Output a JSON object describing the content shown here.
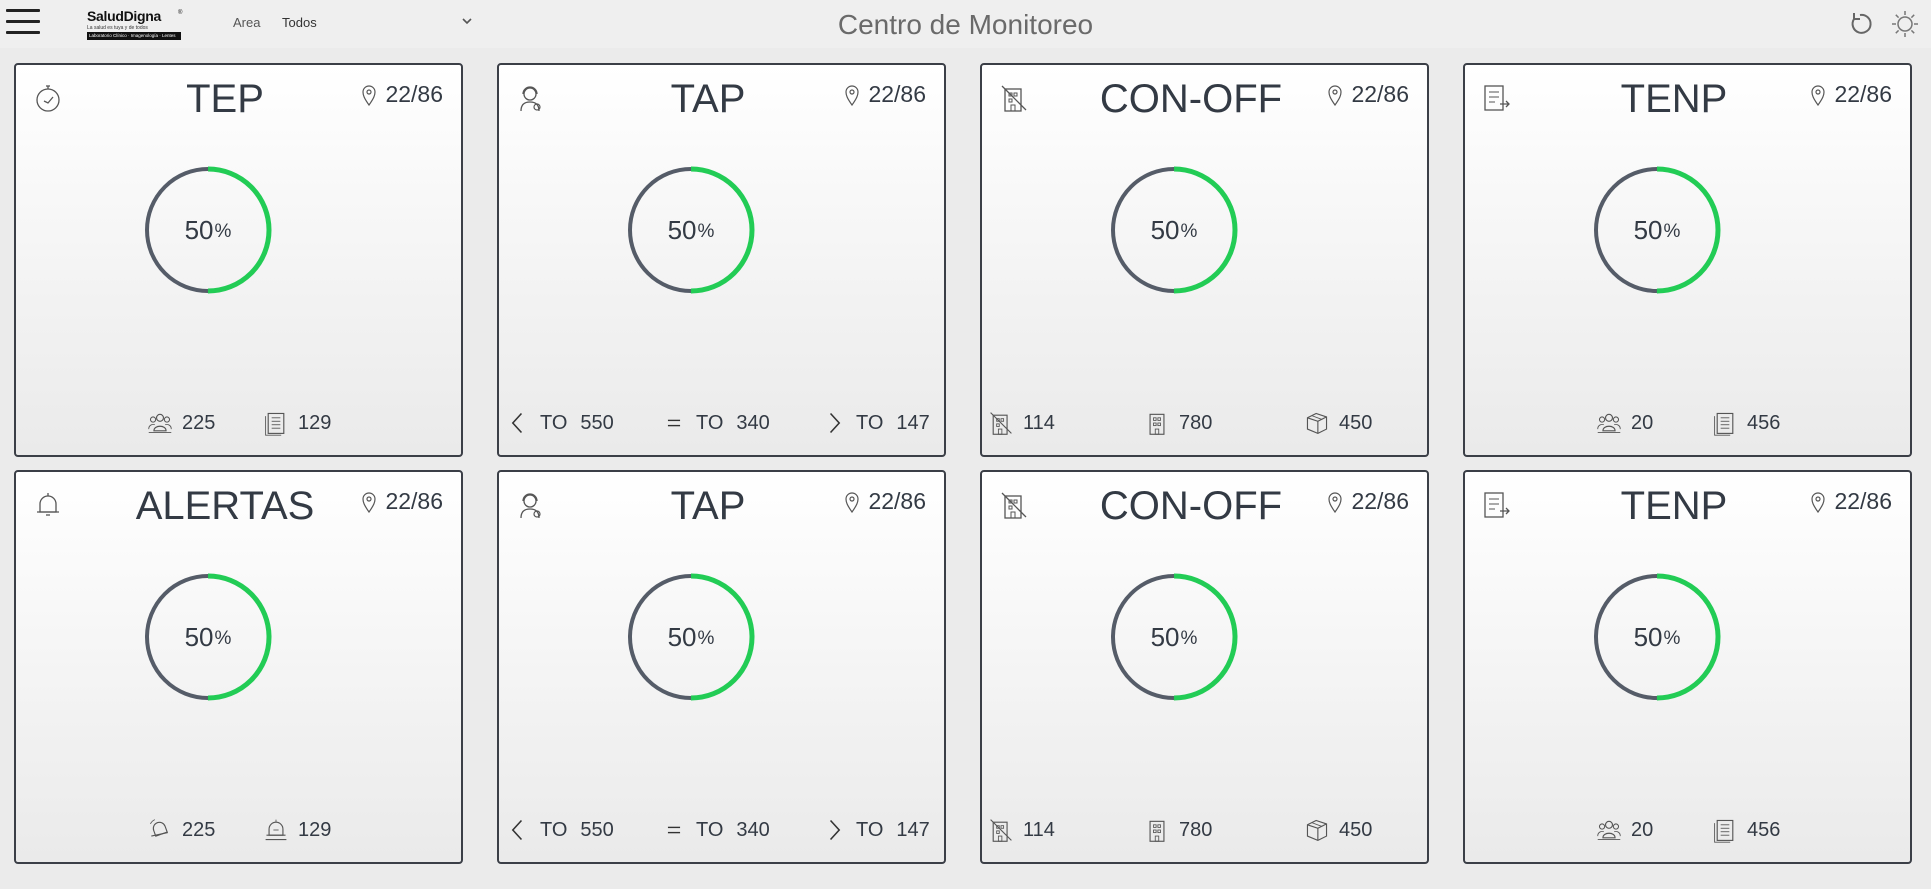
{
  "header": {
    "brand_name": "SaludDigna",
    "brand_reg": "®",
    "brand_tagline": "La salud es tuya y de todos",
    "brand_bar": "Laboratorio Clínico · Imagenología · Lentes",
    "area_label": "Area",
    "area_value": "Todos",
    "title": "Centro de Monitoreo",
    "icons": [
      "menu-icon",
      "chevron-down-icon",
      "refresh-icon",
      "sun-icon"
    ]
  },
  "cards": [
    {
      "title": "TEP",
      "icon": "stopwatch-icon",
      "location": "22/86",
      "percent_value": "50",
      "percent_sign": "%",
      "progress": 0.5,
      "stats": [
        {
          "icon": "users-group-icon",
          "value": "225"
        },
        {
          "icon": "document-list-icon",
          "value": "129"
        }
      ]
    },
    {
      "title": "TAP",
      "icon": "agent-headset-icon",
      "location": "22/86",
      "percent_value": "50",
      "percent_sign": "%",
      "progress": 0.5,
      "stats": [
        {
          "icon": "less-than-icon",
          "prefix": "TO",
          "value": "550"
        },
        {
          "icon": "equals-icon",
          "prefix": "TO",
          "value": "340"
        },
        {
          "icon": "greater-than-icon",
          "prefix": "TO",
          "value": "147"
        }
      ]
    },
    {
      "title": "CON-OFF",
      "icon": "building-offline-icon",
      "location": "22/86",
      "percent_value": "50",
      "percent_sign": "%",
      "progress": 0.5,
      "stats": [
        {
          "icon": "building-offline-icon",
          "value": "114"
        },
        {
          "icon": "building-icon",
          "value": "780"
        },
        {
          "icon": "boxes-icon",
          "value": "450"
        }
      ]
    },
    {
      "title": "TENP",
      "icon": "form-exit-icon",
      "location": "22/86",
      "percent_value": "50",
      "percent_sign": "%",
      "progress": 0.5,
      "stats": [
        {
          "icon": "users-group-icon",
          "value": "20"
        },
        {
          "icon": "document-list-icon",
          "value": "456"
        }
      ]
    },
    {
      "title": "ALERTAS",
      "icon": "bell-icon",
      "location": "22/86",
      "percent_value": "50",
      "percent_sign": "%",
      "progress": 0.5,
      "stats": [
        {
          "icon": "bell-ringing-icon",
          "value": "225"
        },
        {
          "icon": "bell-alert-icon",
          "value": "129"
        }
      ]
    },
    {
      "title": "TAP",
      "icon": "agent-headset-icon",
      "location": "22/86",
      "percent_value": "50",
      "percent_sign": "%",
      "progress": 0.5,
      "stats": [
        {
          "icon": "less-than-icon",
          "prefix": "TO",
          "value": "550"
        },
        {
          "icon": "equals-icon",
          "prefix": "TO",
          "value": "340"
        },
        {
          "icon": "greater-than-icon",
          "prefix": "TO",
          "value": "147"
        }
      ]
    },
    {
      "title": "CON-OFF",
      "icon": "building-offline-icon",
      "location": "22/86",
      "percent_value": "50",
      "percent_sign": "%",
      "progress": 0.5,
      "stats": [
        {
          "icon": "building-offline-icon",
          "value": "114"
        },
        {
          "icon": "building-icon",
          "value": "780"
        },
        {
          "icon": "boxes-icon",
          "value": "450"
        }
      ]
    },
    {
      "title": "TENP",
      "icon": "form-exit-icon",
      "location": "22/86",
      "percent_value": "50",
      "percent_sign": "%",
      "progress": 0.5,
      "stats": [
        {
          "icon": "users-group-icon",
          "value": "20"
        },
        {
          "icon": "document-list-icon",
          "value": "456"
        }
      ]
    }
  ],
  "colors": {
    "gauge_progress": "#22cc55",
    "gauge_track": "#555c68",
    "card_border": "#3b3f47",
    "text": "#333a44"
  }
}
